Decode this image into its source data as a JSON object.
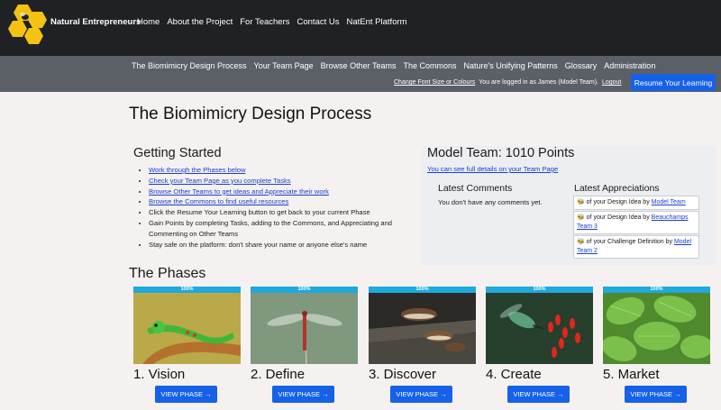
{
  "brand": {
    "name": "Natural Entrepreneurs"
  },
  "top_nav": [
    "Home",
    "About the Project",
    "For Teachers",
    "Contact Us",
    "NatEnt Platform"
  ],
  "sub_nav": [
    "The Biomimicry Design Process",
    "Your Team Page",
    "Browse Other Teams",
    "The Commons",
    "Nature's Unifying Patterns",
    "Glossary",
    "Administration"
  ],
  "status": {
    "change_font": "Change Font Size or Colours",
    "logged_in": "You are logged in as James (Model Team).",
    "logout": "Logout"
  },
  "resume_button": "Resume Your Learning",
  "page_title": "The Biomimicry Design Process",
  "getting_started": {
    "title": "Getting Started",
    "items": [
      {
        "text": "Work through the Phases below",
        "link": true
      },
      {
        "text": "Check your Team Page as you complete Tasks",
        "link": true
      },
      {
        "text": "Browse Other Teams to get ideas and Appreciate their work",
        "link": true
      },
      {
        "text": "Browse the Commons to find useful resources",
        "link": true
      },
      {
        "text": "Click the Resume Your Learning button to get back to your current Phase",
        "link": false
      },
      {
        "text": "Gain Points by completing Tasks, adding to the Commons, and Appreciating and Commenting on Other Teams",
        "link": false
      },
      {
        "text": "Stay safe on the platform: don't share your name or anyone else's name",
        "link": false
      }
    ]
  },
  "team": {
    "title": "Model Team: 1010 Points",
    "details_link": "You can see full details on your Team Page",
    "comments_title": "Latest Comments",
    "comments_empty": "You don't have any comments yet.",
    "appreciations_title": "Latest Appreciations",
    "appreciations": [
      {
        "text": " of your Design Idea by ",
        "who": "Model Team"
      },
      {
        "text": " of your Design Idea by ",
        "who": "Beauchamps Team 3"
      },
      {
        "text": " of your Challenge Definition by ",
        "who": "Model Team 2"
      }
    ]
  },
  "phases_title": "The Phases",
  "phases": [
    {
      "name": "1. Vision",
      "progress": "100%",
      "button": "VIEW PHASE →",
      "image": "green-gecko-on-branch"
    },
    {
      "name": "2. Define",
      "progress": "100%",
      "button": "VIEW PHASE →",
      "image": "red-dragonfly"
    },
    {
      "name": "3. Discover",
      "progress": "100%",
      "button": "VIEW PHASE →",
      "image": "bracket-fungi-on-log"
    },
    {
      "name": "4. Create",
      "progress": "100%",
      "button": "VIEW PHASE →",
      "image": "hummingbird-red-flowers"
    },
    {
      "name": "5. Market",
      "progress": "100%",
      "button": "VIEW PHASE →",
      "image": "green-leaves"
    }
  ]
}
